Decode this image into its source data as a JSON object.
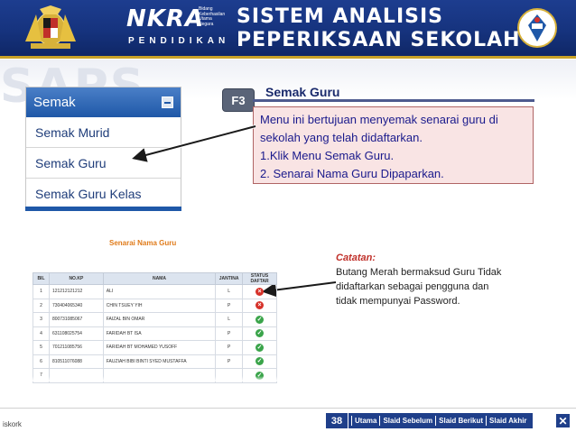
{
  "header": {
    "brand": "NKRA",
    "brand_small": "Bidang\nKeberhasilan\nUtama\nNegara",
    "brand_sub": "PENDIDIKAN",
    "title_line1": "SISTEM ANALISIS",
    "title_line2": "PEPERIKSAAN SEKOLAH"
  },
  "watermark": "SAPS",
  "menu": {
    "header": "Semak",
    "items": [
      "Semak Murid",
      "Semak Guru",
      "Semak Guru Kelas"
    ]
  },
  "step": {
    "badge": "F3",
    "title": "Semak Guru",
    "lines": [
      "Menu ini bertujuan menyemak senarai guru di",
      "sekolah yang telah didaftarkan.",
      "1.Klik Menu Semak Guru.",
      "2. Senarai Nama Guru Dipaparkan."
    ]
  },
  "table": {
    "title": "Senarai Nama Guru",
    "headers": [
      "BIL",
      "NO.KP",
      "NAMA",
      "JANTINA",
      "STATUS DAFTAR"
    ],
    "rows": [
      {
        "bil": "1",
        "kp": "121212121212",
        "nama": "ALI",
        "jantina": "L",
        "status": "red"
      },
      {
        "bil": "2",
        "kp": "730404065340",
        "nama": "CHIN TSUEY YIH",
        "jantina": "P",
        "status": "red"
      },
      {
        "bil": "3",
        "kp": "800731085067",
        "nama": "FAIZAL BIN OMAR",
        "jantina": "L",
        "status": "green"
      },
      {
        "bil": "4",
        "kp": "631108025754",
        "nama": "FARIDAH BT ISA",
        "jantina": "P",
        "status": "green"
      },
      {
        "bil": "5",
        "kp": "701211085756",
        "nama": "FARIDAH BT MOHAMED YUSOFF",
        "jantina": "P",
        "status": "green"
      },
      {
        "bil": "6",
        "kp": "810511076088",
        "nama": "FAUZIAH BIBI BINTI SYED MUSTAFFA",
        "jantina": "P",
        "status": "green"
      },
      {
        "bil": "7",
        "kp": "",
        "nama": "",
        "jantina": "",
        "status": "green"
      }
    ]
  },
  "note": {
    "label": "Catatan",
    "lines": [
      "Butang Merah bermaksud Guru Tidak",
      "didaftarkan sebagai  pengguna dan",
      "tidak mempunyai Password."
    ]
  },
  "footer": {
    "page": "38",
    "nav": [
      "Utama",
      "Slaid Sebelum",
      "Slaid Berikut",
      "Slaid Akhir"
    ],
    "close": "✕",
    "left_text": "iskork"
  },
  "colors": {
    "header_blue": "#16337e",
    "menu_blue": "#1f58a8",
    "info_bg": "#f9e4e4",
    "status_red": "#d6322a",
    "status_green": "#3aa44a",
    "table_title": "#e07b1a"
  }
}
